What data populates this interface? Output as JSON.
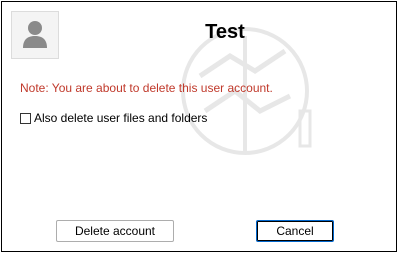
{
  "dialog": {
    "title": "Test",
    "avatar_icon": "user-avatar-icon",
    "watermark_icon": "watermark-emblem-icon",
    "note": "Note: You are about to delete this user account.",
    "note_color": "#c0392b",
    "checkbox": {
      "label": "Also delete user files and folders",
      "checked": false
    },
    "buttons": {
      "delete_label": "Delete account",
      "cancel_label": "Cancel"
    },
    "focus_color": "#0066cc"
  }
}
